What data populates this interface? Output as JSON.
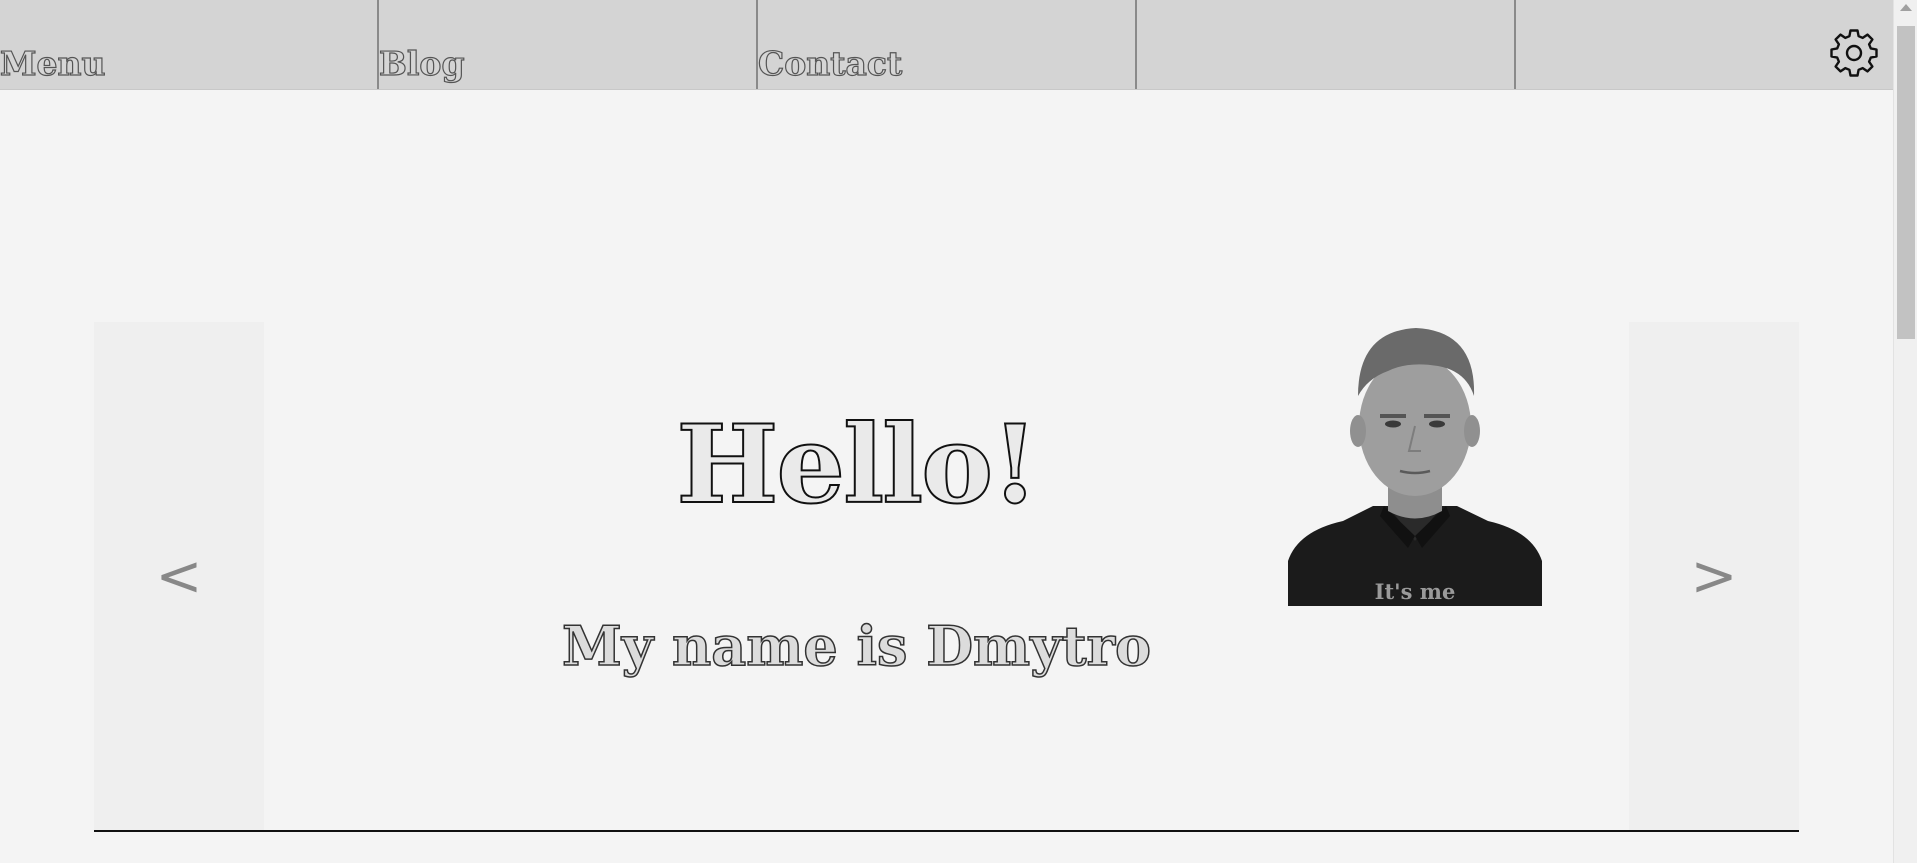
{
  "nav": {
    "items": [
      {
        "label": "Menu"
      },
      {
        "label": "Blog"
      },
      {
        "label": "Contact"
      },
      {
        "label": ""
      }
    ],
    "settings_icon": "gear-icon"
  },
  "slider": {
    "prev_label": "<",
    "next_label": ">",
    "heading": "Hello!",
    "subheading": "My name is Dmytro",
    "photo_caption": "It's me"
  },
  "colors": {
    "nav_bg": "#d4d4d4",
    "page_bg": "#f4f4f4",
    "side_bg": "#efefef"
  }
}
